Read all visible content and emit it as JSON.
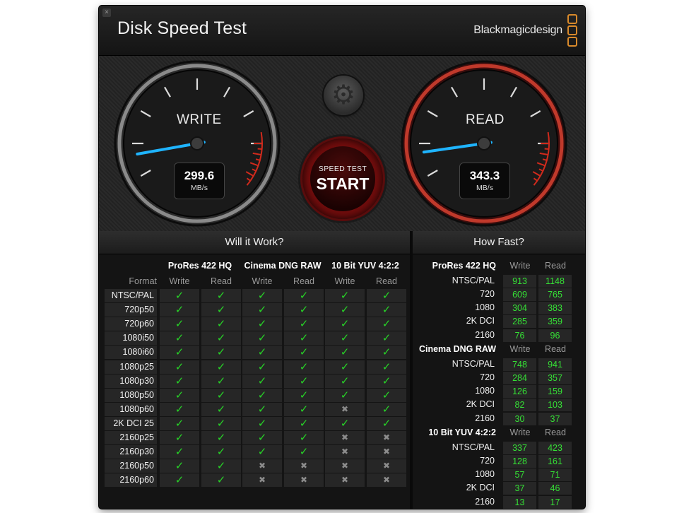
{
  "window": {
    "title": "Disk Speed Test",
    "close_glyph": "×",
    "brand": "Blackmagicdesign"
  },
  "gauges": {
    "write": {
      "label": "WRITE",
      "value": "299.6",
      "unit": "MB/s",
      "speed": 299.6
    },
    "read": {
      "label": "READ",
      "value": "343.3",
      "unit": "MB/s",
      "speed": 343.3
    },
    "settings_icon": "gear-icon",
    "start": {
      "top": "SPEED TEST",
      "main": "START"
    },
    "accent_red": "#c0392b",
    "needle_blue": "#1fb4ff"
  },
  "will_it_work": {
    "title": "Will it Work?",
    "format_header": "Format",
    "groups": [
      "ProRes 422 HQ",
      "Cinema DNG RAW",
      "10 Bit YUV 4:2:2"
    ],
    "sub_headers": [
      "Write",
      "Read",
      "Write",
      "Read",
      "Write",
      "Read"
    ],
    "check_glyph": "✓",
    "cross_glyph": "✖",
    "rows": [
      {
        "format": "NTSC/PAL",
        "ok": [
          1,
          1,
          1,
          1,
          1,
          1
        ]
      },
      {
        "format": "720p50",
        "ok": [
          1,
          1,
          1,
          1,
          1,
          1
        ]
      },
      {
        "format": "720p60",
        "ok": [
          1,
          1,
          1,
          1,
          1,
          1
        ]
      },
      {
        "format": "1080i50",
        "ok": [
          1,
          1,
          1,
          1,
          1,
          1
        ]
      },
      {
        "format": "1080i60",
        "ok": [
          1,
          1,
          1,
          1,
          1,
          1
        ]
      },
      {
        "format": "1080p25",
        "ok": [
          1,
          1,
          1,
          1,
          1,
          1
        ]
      },
      {
        "format": "1080p30",
        "ok": [
          1,
          1,
          1,
          1,
          1,
          1
        ]
      },
      {
        "format": "1080p50",
        "ok": [
          1,
          1,
          1,
          1,
          1,
          1
        ]
      },
      {
        "format": "1080p60",
        "ok": [
          1,
          1,
          1,
          1,
          0,
          1
        ]
      },
      {
        "format": "2K DCI 25",
        "ok": [
          1,
          1,
          1,
          1,
          1,
          1
        ]
      },
      {
        "format": "2160p25",
        "ok": [
          1,
          1,
          1,
          1,
          0,
          0
        ]
      },
      {
        "format": "2160p30",
        "ok": [
          1,
          1,
          1,
          1,
          0,
          0
        ]
      },
      {
        "format": "2160p50",
        "ok": [
          1,
          1,
          0,
          0,
          0,
          0
        ]
      },
      {
        "format": "2160p60",
        "ok": [
          1,
          1,
          0,
          0,
          0,
          0
        ]
      }
    ]
  },
  "how_fast": {
    "title": "How Fast?",
    "write_header": "Write",
    "read_header": "Read",
    "groups": [
      {
        "name": "ProRes 422 HQ",
        "rows": [
          {
            "label": "NTSC/PAL",
            "write": "913",
            "read": "1148"
          },
          {
            "label": "720",
            "write": "609",
            "read": "765"
          },
          {
            "label": "1080",
            "write": "304",
            "read": "383"
          },
          {
            "label": "2K DCI",
            "write": "285",
            "read": "359"
          },
          {
            "label": "2160",
            "write": "76",
            "read": "96"
          }
        ]
      },
      {
        "name": "Cinema DNG RAW",
        "rows": [
          {
            "label": "NTSC/PAL",
            "write": "748",
            "read": "941"
          },
          {
            "label": "720",
            "write": "284",
            "read": "357"
          },
          {
            "label": "1080",
            "write": "126",
            "read": "159"
          },
          {
            "label": "2K DCI",
            "write": "82",
            "read": "103"
          },
          {
            "label": "2160",
            "write": "30",
            "read": "37"
          }
        ]
      },
      {
        "name": "10 Bit YUV 4:2:2",
        "rows": [
          {
            "label": "NTSC/PAL",
            "write": "337",
            "read": "423"
          },
          {
            "label": "720",
            "write": "128",
            "read": "161"
          },
          {
            "label": "1080",
            "write": "57",
            "read": "71"
          },
          {
            "label": "2K DCI",
            "write": "37",
            "read": "46"
          },
          {
            "label": "2160",
            "write": "13",
            "read": "17"
          }
        ]
      }
    ]
  }
}
